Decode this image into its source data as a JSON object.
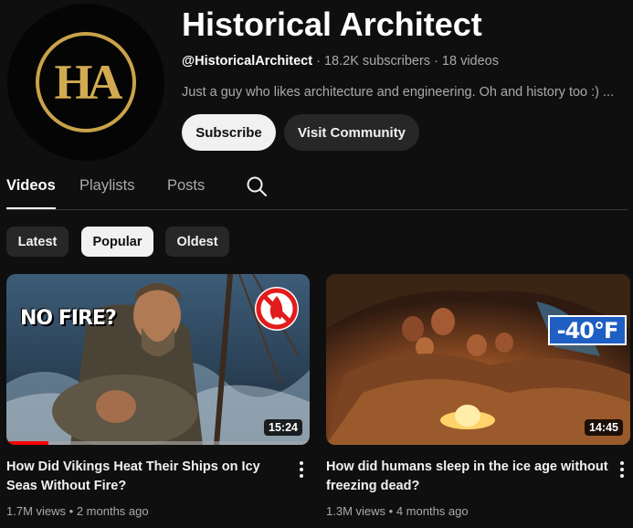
{
  "channel": {
    "name": "Historical Architect",
    "handle": "@HistoricalArchitect",
    "subscribers": "18.2K subscribers",
    "videos_count": "18 videos",
    "description": "Just a guy who likes architecture and engineering. Oh and history too :) ...",
    "avatar_text": "HA",
    "subscribe_label": "Subscribe",
    "community_label": "Visit Community"
  },
  "tabs": [
    {
      "label": "Videos",
      "active": true
    },
    {
      "label": "Playlists",
      "active": false
    },
    {
      "label": "Posts",
      "active": false
    }
  ],
  "filters": [
    {
      "label": "Latest",
      "selected": false
    },
    {
      "label": "Popular",
      "selected": true
    },
    {
      "label": "Oldest",
      "selected": false
    }
  ],
  "videos": [
    {
      "title": "How Did Vikings Heat Their Ships on Icy Seas Without Fire?",
      "views": "1.7M views",
      "age": "2 months ago",
      "duration": "15:24",
      "thumb_text": "NO FIRE?",
      "watch_progress": 0.14
    },
    {
      "title": "How did humans sleep in the ice age without freezing dead?",
      "views": "1.3M views",
      "age": "4 months ago",
      "duration": "14:45",
      "thumb_text": "-40°F",
      "watch_progress": 0
    }
  ],
  "colors": {
    "background": "#0f0f0f",
    "accent_gold": "#c9a24a",
    "progress_red": "#ff0000",
    "secondary_text": "#aaaaaa"
  }
}
